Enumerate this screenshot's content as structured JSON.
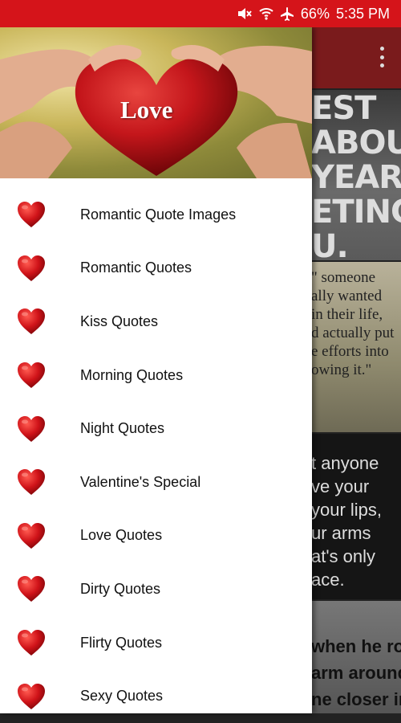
{
  "status_bar": {
    "battery": "66%",
    "time": "5:35 PM",
    "icons": [
      "mute-icon",
      "wifi-icon",
      "airplane-icon"
    ],
    "color": "#d5141a"
  },
  "header": {
    "title": "Love"
  },
  "menu": {
    "items": [
      {
        "label": "Romantic Quote Images",
        "icon": "heart-icon"
      },
      {
        "label": "Romantic Quotes",
        "icon": "heart-icon"
      },
      {
        "label": "Kiss Quotes",
        "icon": "heart-icon"
      },
      {
        "label": "Morning Quotes",
        "icon": "heart-icon"
      },
      {
        "label": "Night Quotes",
        "icon": "heart-icon"
      },
      {
        "label": "Valentine's Special",
        "icon": "heart-icon"
      },
      {
        "label": "Love Quotes",
        "icon": "heart-icon"
      },
      {
        "label": "Dirty Quotes",
        "icon": "heart-icon"
      },
      {
        "label": "Flirty Quotes",
        "icon": "heart-icon"
      },
      {
        "label": "Sexy Quotes",
        "icon": "heart-icon"
      }
    ]
  },
  "background": {
    "cards": [
      {
        "text": "EST\nABOUT\nYEAR\nETING\nU."
      },
      {
        "text": "\" someone\nally wanted\nin their life,\nd actually put\ne efforts into\nowing it.\""
      },
      {
        "text": "t anyone\nve your\nyour lips,\nur arms\nat's only\nace."
      },
      {
        "text": "when he rolls\narm around\nne closer in"
      }
    ]
  }
}
